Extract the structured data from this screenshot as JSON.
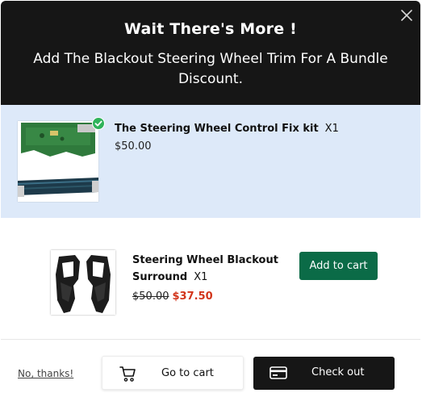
{
  "header": {
    "title": "Wait There's More !",
    "subtitle": "Add The Blackout Steering Wheel Trim For A Bundle Discount."
  },
  "products": [
    {
      "name": "The Steering Wheel Control Fix kit",
      "qty": "X1",
      "price": "$50.00",
      "selected": true
    },
    {
      "name": "Steering Wheel Blackout Surround",
      "qty": "X1",
      "original_price": "$50.00",
      "sale_price": "$37.50",
      "add_label": "Add to cart"
    }
  ],
  "footer": {
    "decline_label": "No, thanks!",
    "go_to_cart_label": "Go to cart",
    "checkout_label": "Check out"
  },
  "colors": {
    "header_bg": "#161616",
    "selected_row_bg": "#dde9f9",
    "add_button_bg": "#0b6b47",
    "sale_price": "#d2351b",
    "check_badge": "#2fb35a"
  },
  "icons": [
    "close-icon",
    "check-icon",
    "cart-icon",
    "credit-card-icon"
  ]
}
